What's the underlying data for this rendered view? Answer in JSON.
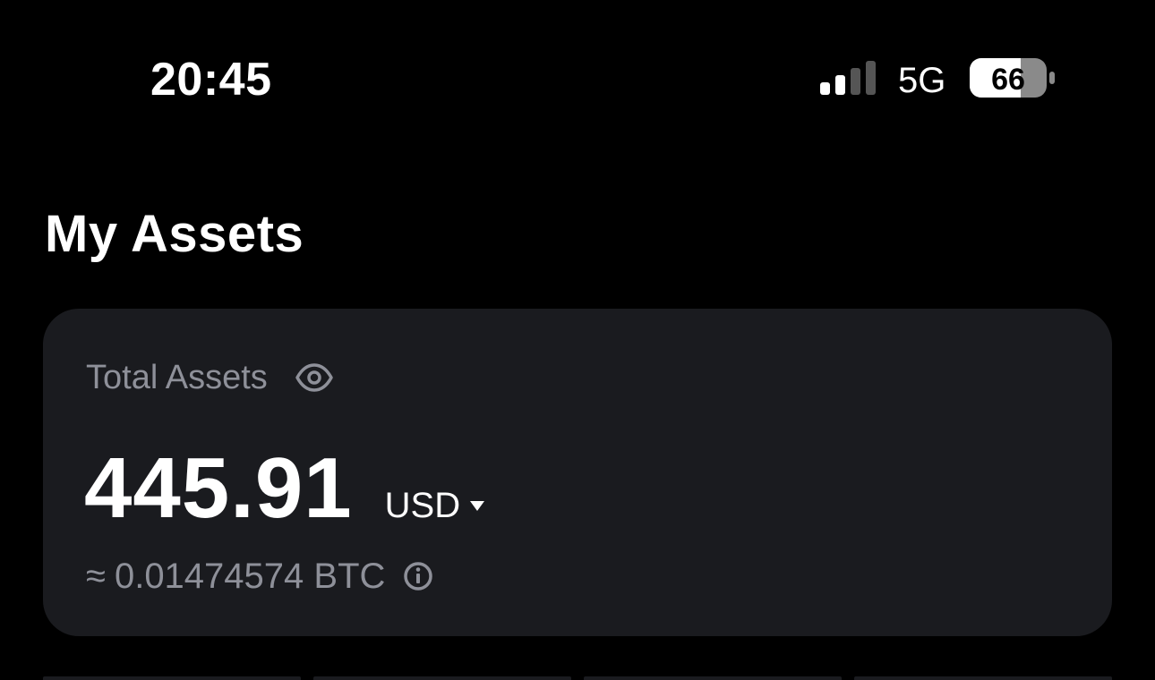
{
  "status_bar": {
    "time": "20:45",
    "network": "5G",
    "battery_level": "66",
    "signal_bars_active": 2,
    "signal_bars_total": 4
  },
  "page": {
    "title": "My Assets"
  },
  "assets_card": {
    "label": "Total Assets",
    "amount": "445.91",
    "currency": "USD",
    "approx_symbol": "≈",
    "btc_equivalent": "0.01474574 BTC"
  },
  "icons": {
    "visibility": "eye-icon",
    "currency_toggle": "caret-down-icon",
    "info": "info-icon"
  },
  "colors": {
    "background": "#000000",
    "card": "#1a1b1f",
    "text_primary": "#ffffff",
    "text_secondary": "#8e9099"
  }
}
